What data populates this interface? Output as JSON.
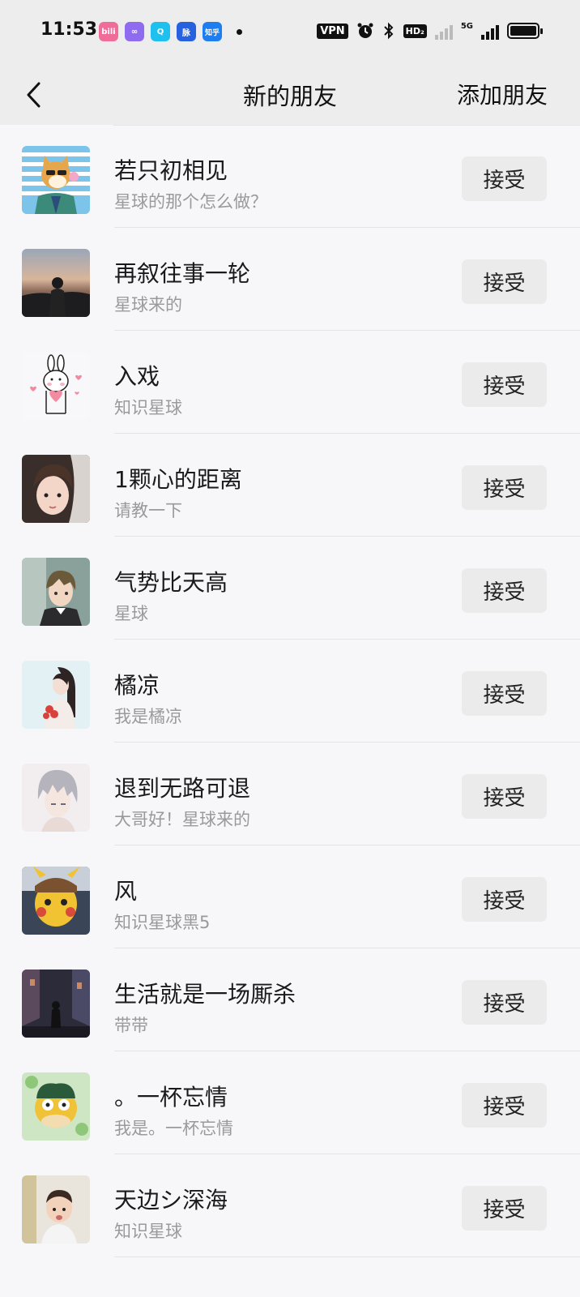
{
  "status_bar": {
    "time": "11:53",
    "apps": [
      {
        "name": "bilibili-app-icon",
        "label": "bili",
        "color": "#f06d99"
      },
      {
        "name": "soul-app-icon",
        "label": "∞",
        "color": "#8f6bf0"
      },
      {
        "name": "qq-app-icon",
        "label": "Q",
        "color": "#1ec0f0"
      },
      {
        "name": "maimai-app-icon",
        "label": "脉",
        "color": "#2861e0"
      },
      {
        "name": "zhihu-app-icon",
        "label": "知乎",
        "color": "#1e7ef0"
      }
    ],
    "vpn": "VPN",
    "hd": "HD₂",
    "network": "5G"
  },
  "nav": {
    "title": "新的朋友",
    "action": "添加朋友"
  },
  "requests": [
    {
      "name": "若只初相见",
      "message": "星球的那个怎么做？",
      "button": "接受"
    },
    {
      "name": "再叙往事一轮",
      "message": "星球来的",
      "button": "接受"
    },
    {
      "name": "入戏",
      "message": "知识星球",
      "button": "接受"
    },
    {
      "name": "1颗心的距离",
      "message": "请教一下",
      "button": "接受"
    },
    {
      "name": "气势比天高",
      "message": "星球",
      "button": "接受"
    },
    {
      "name": "橘凉",
      "message": "我是橘凉",
      "button": "接受"
    },
    {
      "name": "退到无路可退",
      "message": "大哥好！星球来的",
      "button": "接受"
    },
    {
      "name": "风",
      "message": "知识星球黑5",
      "button": "接受"
    },
    {
      "name": "生活就是一场厮杀",
      "message": "带带",
      "button": "接受"
    },
    {
      "name": "。一杯忘情",
      "message": "我是。一杯忘情",
      "button": "接受"
    },
    {
      "name": "天边シ深海",
      "message": "知识星球",
      "button": "接受"
    }
  ]
}
